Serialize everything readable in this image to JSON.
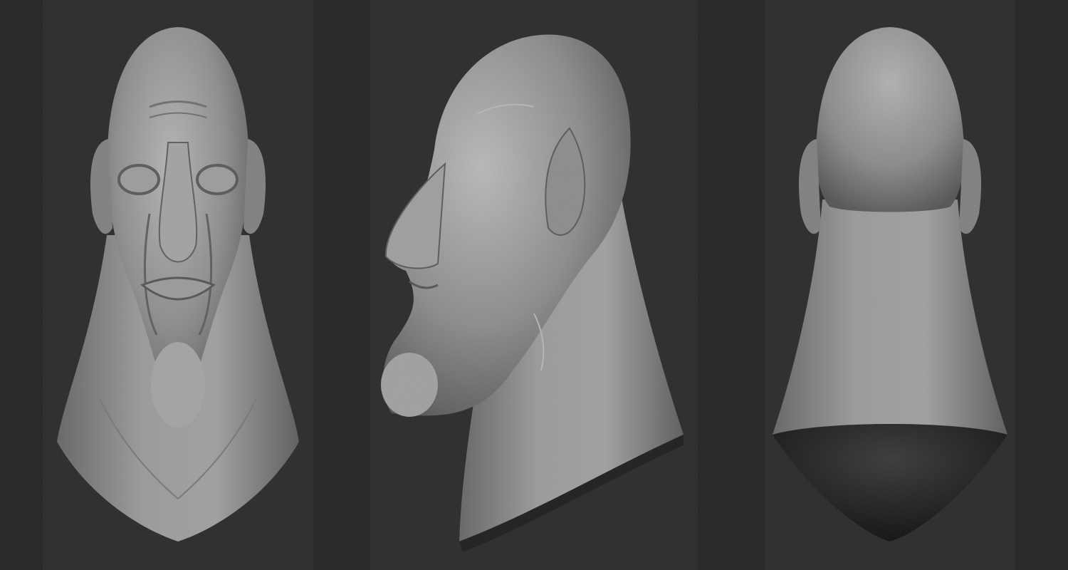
{
  "scene": {
    "background_color": "#2b2b2b",
    "views": [
      {
        "name": "front-view"
      },
      {
        "name": "side-view"
      },
      {
        "name": "back-view"
      }
    ],
    "material_color": "#8f8f8f"
  }
}
